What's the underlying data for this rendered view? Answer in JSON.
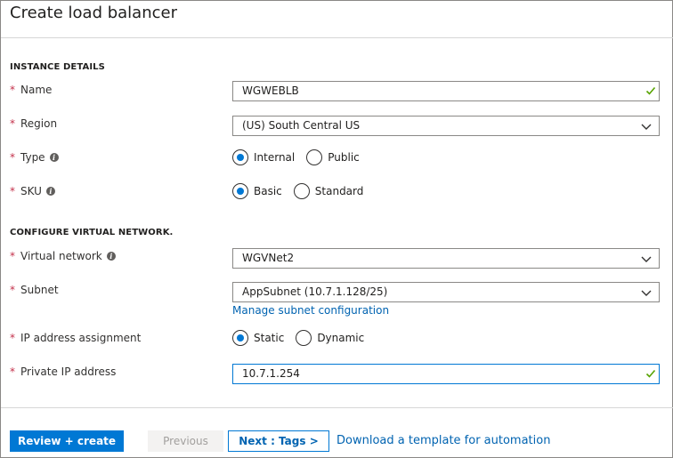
{
  "header": {
    "title": "Create load balancer"
  },
  "instance_details": {
    "section_title": "INSTANCE DETAILS",
    "name": {
      "label": "Name",
      "value": "WGWEBLB"
    },
    "region": {
      "label": "Region",
      "value": "(US) South Central US"
    },
    "type": {
      "label": "Type",
      "options": [
        "Internal",
        "Public"
      ],
      "selected": "Internal"
    },
    "sku": {
      "label": "SKU",
      "options": [
        "Basic",
        "Standard"
      ],
      "selected": "Basic"
    }
  },
  "virtual_network": {
    "section_title": "CONFIGURE VIRTUAL NETWORK.",
    "vnet": {
      "label": "Virtual network",
      "value": "WGVNet2"
    },
    "subnet": {
      "label": "Subnet",
      "value": "AppSubnet (10.7.1.128/25)",
      "manage_link": "Manage subnet configuration"
    },
    "ip_assignment": {
      "label": "IP address assignment",
      "options": [
        "Static",
        "Dynamic"
      ],
      "selected": "Static"
    },
    "private_ip": {
      "label": "Private IP address",
      "value": "10.7.1.254"
    }
  },
  "footer": {
    "review_create": "Review + create",
    "previous": "Previous",
    "next": "Next : Tags >",
    "download_template": "Download a template for automation"
  },
  "colors": {
    "accent": "#0078d4",
    "required": "#c4314b",
    "valid": "#57a300"
  },
  "required_marker": "*",
  "icons": [
    "check-icon",
    "chevron-down-icon",
    "info-icon"
  ]
}
